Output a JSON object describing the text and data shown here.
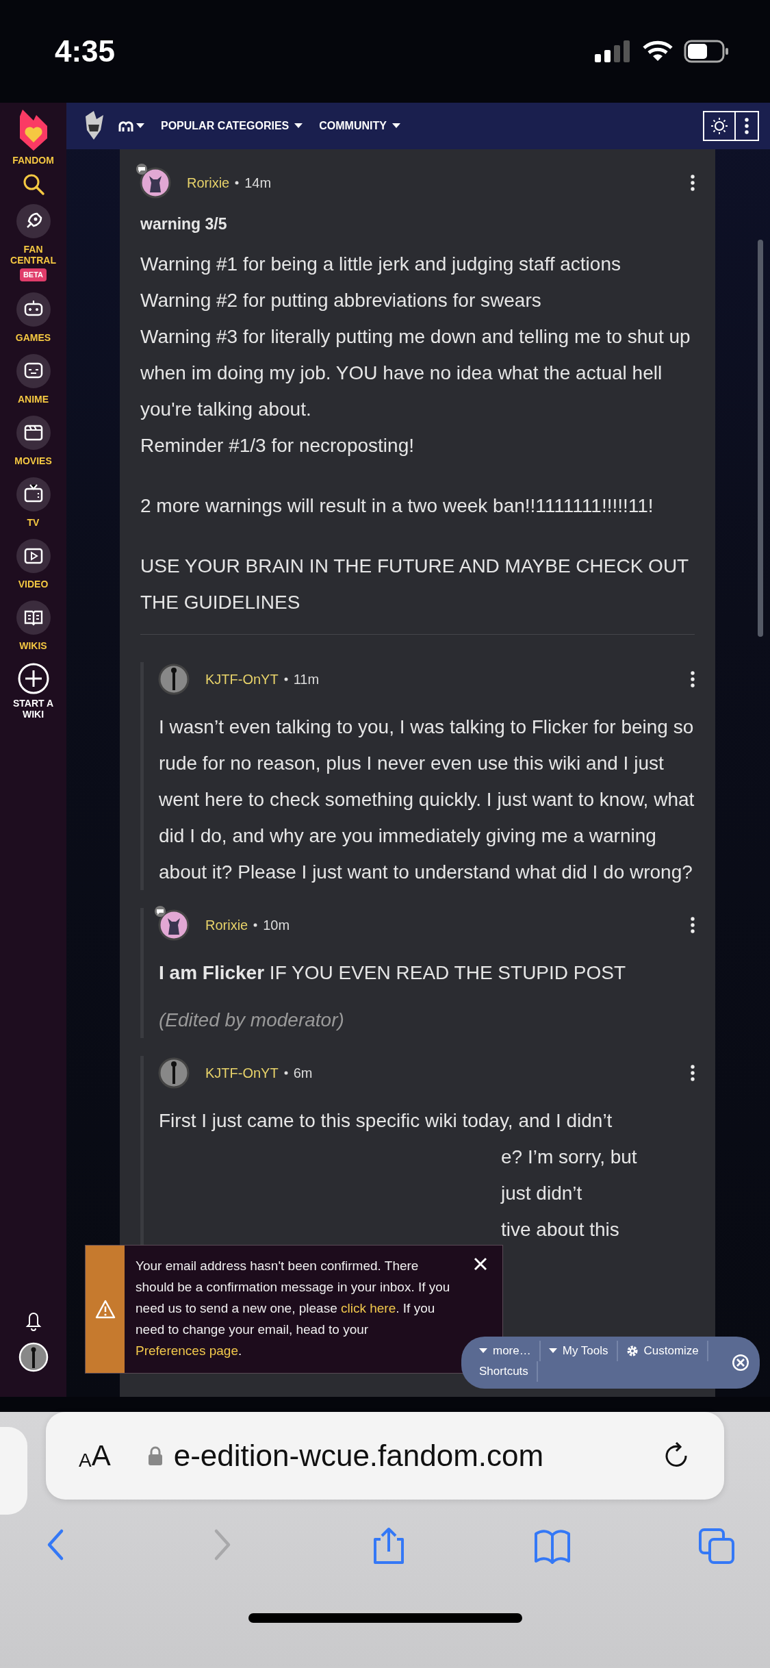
{
  "status_bar": {
    "time": "4:35"
  },
  "sidebar": {
    "brand": "FANDOM",
    "items": [
      {
        "label": "FAN CENTRAL",
        "badge": "BETA",
        "kind": "rocket"
      },
      {
        "label": "GAMES",
        "kind": "controller"
      },
      {
        "label": "ANIME",
        "kind": "face"
      },
      {
        "label": "MOVIES",
        "kind": "clapper"
      },
      {
        "label": "TV",
        "kind": "tv"
      },
      {
        "label": "VIDEO",
        "kind": "play"
      },
      {
        "label": "WIKIS",
        "kind": "book"
      },
      {
        "label": "START A WIKI",
        "kind": "plus"
      }
    ]
  },
  "nav": {
    "menus": [
      "POPULAR CATEGORIES",
      "COMMUNITY"
    ]
  },
  "comments": [
    {
      "author": "Rorixie",
      "time": "14m",
      "mod_badge": true,
      "reply": false,
      "title": "warning 3/5",
      "paragraphs": [
        [
          "Warning #1 for being a little jerk and judging staff actions",
          "Warning #2 for putting abbreviations for swears",
          "Warning #3 for literally putting me down and telling me to shut up when im doing my job. YOU have no idea what the actual hell you're talking about.",
          "Reminder #1/3 for necroposting!"
        ],
        [
          "2 more warnings will result in a two week ban!!1111111!!!!!11!"
        ],
        [
          "USE YOUR BRAIN IN THE FUTURE AND MAYBE CHECK OUT THE GUIDELINES"
        ]
      ]
    },
    {
      "author": "KJTF-OnYT",
      "time": "11m",
      "mod_badge": false,
      "reply": true,
      "paragraphs": [
        [
          "I wasn’t even talking to you, I was talking to Flicker for being so rude for no reason, plus I never even use this wiki and I just went here to check something quickly. I just want to know, what did I do, and why are you immediately giving me a warning about it? Please I just want to understand what did I do wrong?"
        ]
      ]
    },
    {
      "author": "Rorixie",
      "time": "10m",
      "mod_badge": true,
      "reply": true,
      "paragraphs": [
        [
          "**I am Flicker** IF YOU EVEN READ THE STUPID POST"
        ]
      ],
      "edit_note": "(Edited by moderator)"
    },
    {
      "author": "KJTF-OnYT",
      "time": "6m",
      "mod_badge": false,
      "reply": true,
      "paragraphs": [
        [
          "First I just came to this specific wiki today, and I didn’t"
        ]
      ],
      "covered_fragments": [
        "e? I’m sorry, but",
        "just didn’t",
        "tive about this"
      ]
    }
  ],
  "notification": {
    "parts": [
      {
        "kind": "text",
        "text": "Your email address hasn't been confirmed. There should be a confirmation message in your inbox. If you need us to send a new one, please "
      },
      {
        "kind": "link",
        "text": "click here"
      },
      {
        "kind": "text",
        "text": ". If you need to change your email, head to your "
      },
      {
        "kind": "link",
        "text": "Preferences page"
      },
      {
        "kind": "text",
        "text": "."
      }
    ]
  },
  "toolbar": {
    "items": [
      {
        "label": "more…",
        "kind": "dropdown"
      },
      {
        "label": "My Tools",
        "kind": "dropdown"
      },
      {
        "label": "Customize",
        "kind": "gear"
      },
      {
        "label": "Shortcuts",
        "kind": "plain"
      }
    ]
  },
  "browser": {
    "reader_button": "AA",
    "url": "e-edition-wcue.fandom.com",
    "nav_buttons": [
      {
        "kind": "back",
        "disabled": false
      },
      {
        "kind": "forward",
        "disabled": true
      },
      {
        "kind": "share",
        "disabled": false
      },
      {
        "kind": "bookmarks",
        "disabled": false
      },
      {
        "kind": "tabs",
        "disabled": false
      }
    ]
  }
}
